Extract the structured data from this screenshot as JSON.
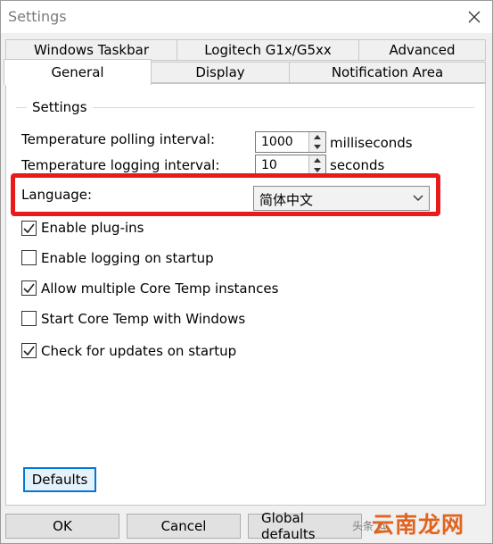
{
  "window": {
    "title": "Settings"
  },
  "tabs": {
    "row1": [
      "Windows Taskbar",
      "Logitech G1x/G5xx",
      "Advanced"
    ],
    "row2": [
      "General",
      "Display",
      "Notification Area"
    ],
    "selected": "General"
  },
  "group": {
    "legend": "Settings"
  },
  "polling": {
    "label": "Temperature polling interval:",
    "value": "1000",
    "unit": "milliseconds"
  },
  "logging": {
    "label": "Temperature logging interval:",
    "value": "10",
    "unit": "seconds"
  },
  "language": {
    "label": "Language:",
    "selected": "简体中文"
  },
  "checkboxes": [
    {
      "label": "Enable plug-ins",
      "checked": true
    },
    {
      "label": "Enable logging on startup",
      "checked": false
    },
    {
      "label": "Allow multiple Core Temp instances",
      "checked": true
    },
    {
      "label": "Start Core Temp with Windows",
      "checked": false
    },
    {
      "label": "Check for updates on startup",
      "checked": true
    }
  ],
  "buttons": {
    "defaults": "Defaults",
    "ok": "OK",
    "cancel": "Cancel",
    "global_defaults": "Global defaults"
  },
  "watermark": {
    "small": "头条 @",
    "big": "云南龙网"
  },
  "colors": {
    "highlight": "#e81a1a",
    "focus": "#0078d7",
    "watermark": "#e0641e"
  }
}
